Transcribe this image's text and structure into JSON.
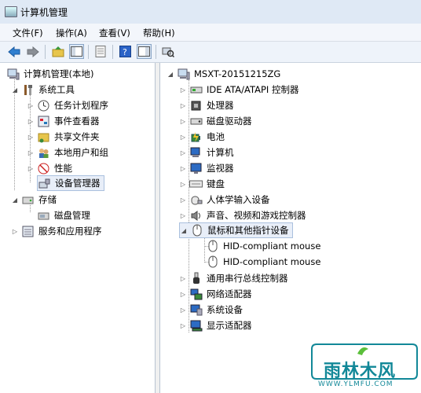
{
  "window": {
    "title": "计算机管理"
  },
  "menu": [
    "文件(F)",
    "操作(A)",
    "查看(V)",
    "帮助(H)"
  ],
  "left_tree": {
    "root": "计算机管理(本地)",
    "system_tools": "系统工具",
    "task_scheduler": "任务计划程序",
    "event_viewer": "事件查看器",
    "shared_folders": "共享文件夹",
    "local_users": "本地用户和组",
    "performance": "性能",
    "device_manager": "设备管理器",
    "storage": "存储",
    "disk_management": "磁盘管理",
    "services": "服务和应用程序"
  },
  "device_tree": {
    "computer_name": "MSXT-20151215ZG",
    "categories": [
      {
        "label": "IDE ATA/ATAPI 控制器",
        "icon": "ide-controller-icon"
      },
      {
        "label": "处理器",
        "icon": "processor-icon"
      },
      {
        "label": "磁盘驱动器",
        "icon": "disk-drive-icon"
      },
      {
        "label": "电池",
        "icon": "battery-icon"
      },
      {
        "label": "计算机",
        "icon": "computer-icon"
      },
      {
        "label": "监视器",
        "icon": "monitor-icon"
      },
      {
        "label": "键盘",
        "icon": "keyboard-icon"
      },
      {
        "label": "人体学输入设备",
        "icon": "hid-icon"
      },
      {
        "label": "声音、视频和游戏控制器",
        "icon": "sound-icon"
      },
      {
        "label": "鼠标和其他指针设备",
        "icon": "mouse-icon"
      }
    ],
    "mouse_children": [
      "HID-compliant mouse",
      "HID-compliant mouse"
    ],
    "more_categories": [
      {
        "label": "通用串行总线控制器",
        "icon": "usb-icon"
      },
      {
        "label": "网络适配器",
        "icon": "network-icon"
      },
      {
        "label": "系统设备",
        "icon": "system-devices-icon"
      },
      {
        "label": "显示适配器",
        "icon": "display-adapter-icon"
      }
    ]
  },
  "watermark": {
    "text": "雨林木风",
    "url": "WWW.YLMFU.COM"
  }
}
